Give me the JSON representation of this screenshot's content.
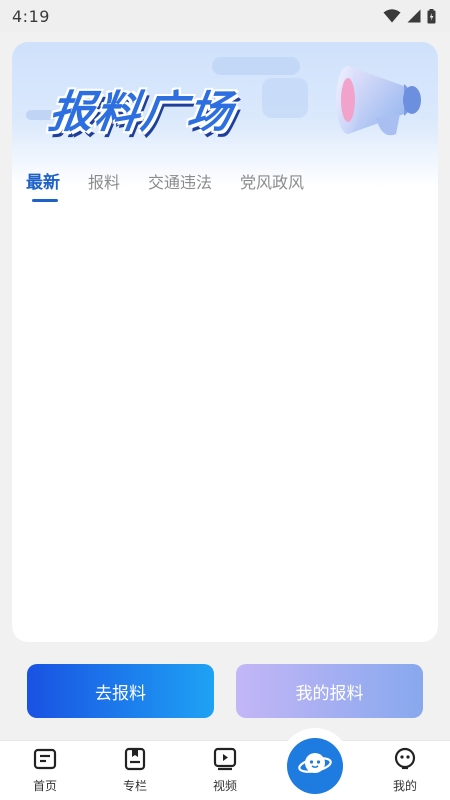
{
  "status_bar": {
    "time": "4:19",
    "icons": [
      "wifi-icon",
      "signal-icon",
      "battery-icon"
    ]
  },
  "banner": {
    "title": "报料广场",
    "icon": "megaphone-icon"
  },
  "tabs": [
    {
      "label": "最新",
      "active": true
    },
    {
      "label": "报料",
      "active": false
    },
    {
      "label": "交通违法",
      "active": false
    },
    {
      "label": "党风政风",
      "active": false
    }
  ],
  "actions": {
    "report_label": "去报料",
    "my_report_label": "我的报料"
  },
  "bottom_nav": {
    "items": [
      {
        "label": "首页",
        "icon": "home-news-icon"
      },
      {
        "label": "专栏",
        "icon": "column-bookmark-icon"
      },
      {
        "label": "视频",
        "icon": "video-play-icon"
      },
      {
        "label": "",
        "icon": "planet-mascot-icon"
      },
      {
        "label": "我的",
        "icon": "robot-face-icon"
      }
    ]
  },
  "colors": {
    "accent": "#1e62c9",
    "report_button_start": "#1a52e3",
    "report_button_end": "#1ea2f4",
    "my_report_button_start": "#c3b6f6",
    "my_report_button_end": "#88a8ee",
    "center_button": "#1e7be0"
  }
}
